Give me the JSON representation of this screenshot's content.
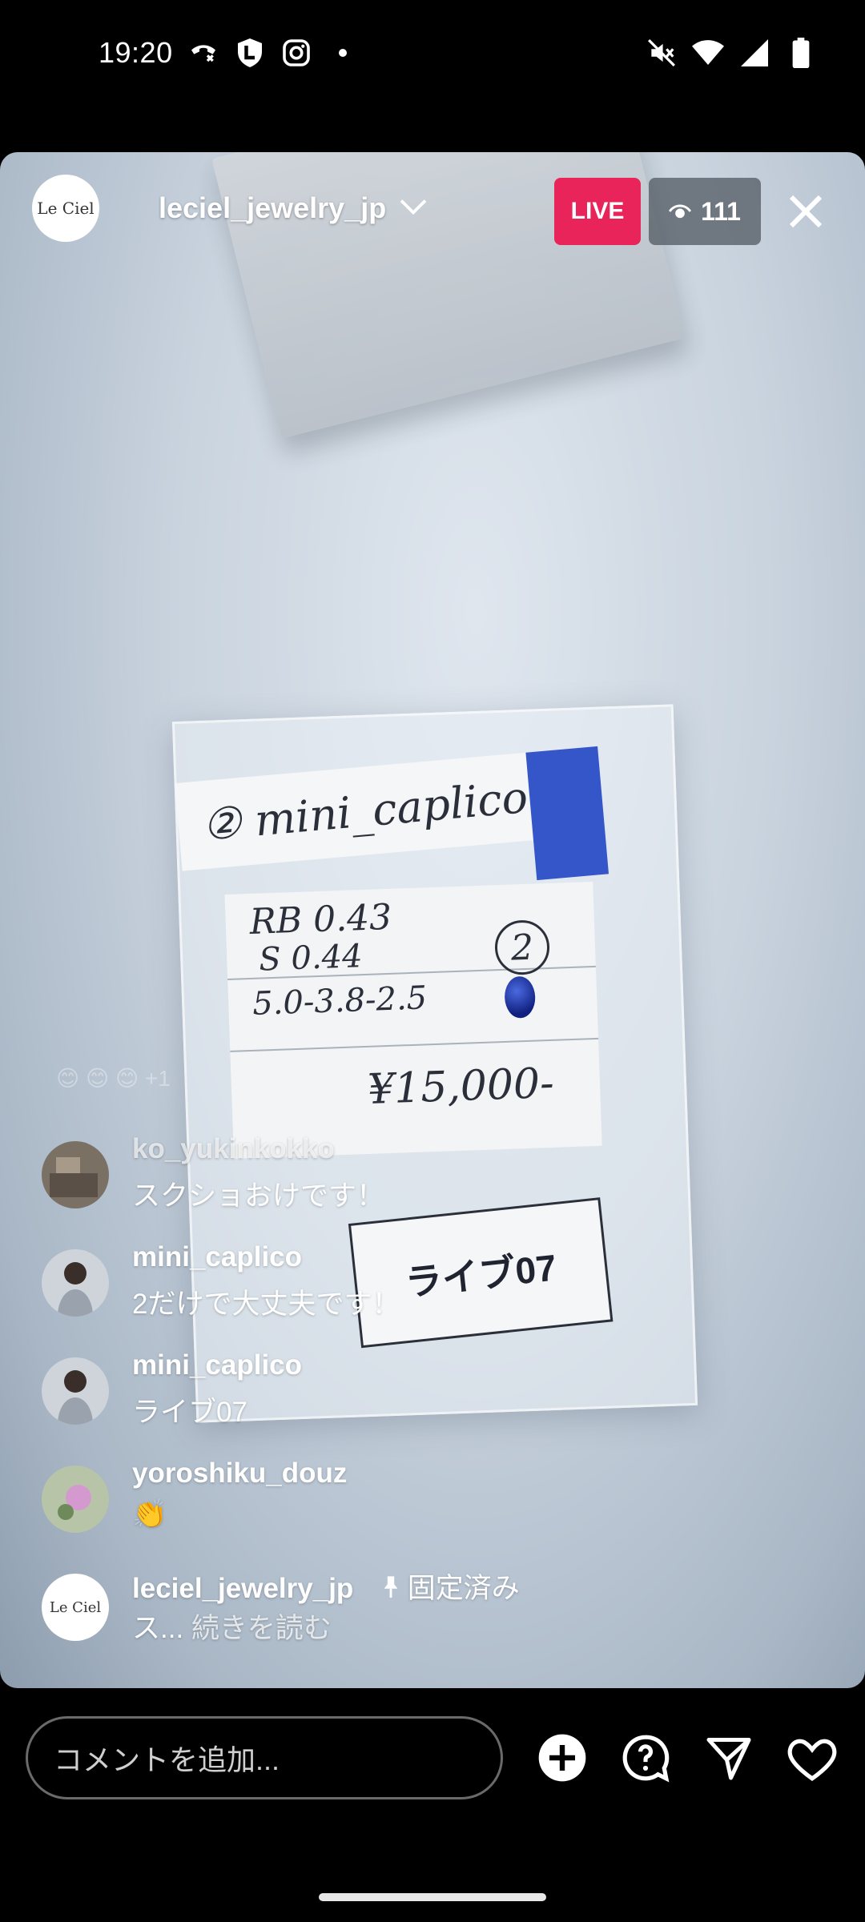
{
  "status_bar": {
    "time": "19:20",
    "icons_left": [
      "call-forward-icon",
      "shield-l-icon",
      "instagram-icon",
      "dot-icon"
    ],
    "icons_right": [
      "mute-icon",
      "wifi-icon",
      "signal-icon",
      "battery-icon"
    ]
  },
  "live": {
    "host_username": "leciel_jewelry_jp",
    "host_avatar_text": "Le Ciel",
    "live_label": "LIVE",
    "viewer_count": "111"
  },
  "video_content": {
    "label_top": "② mini_caplico",
    "card_line1": "RB 0.43",
    "card_line2": "S 0.44",
    "card_line3": "5.0-3.8-2.5",
    "card_price": "¥15,000-",
    "circle_number": "2",
    "live_tag": "ライブ07"
  },
  "comments": [
    {
      "username": "ko_yukinkokko",
      "text": "スクショおけです！"
    },
    {
      "username": "mini_caplico",
      "text": "2だけで大丈夫です！"
    },
    {
      "username": "mini_caplico",
      "text": "ライブ07"
    },
    {
      "username": "yoroshiku_douz",
      "text": "👏"
    },
    {
      "username": "leciel_jewelry_jp",
      "pinned_label": "固定済み",
      "text": "ス...",
      "more_label": "続きを読む",
      "avatar_text": "Le Ciel"
    }
  ],
  "faded_reactions": "😊 😊 😊 +1",
  "bottom": {
    "comment_placeholder": "コメントを追加..."
  },
  "colors": {
    "live_badge": "#e8245a",
    "viewer_badge": "#50585f"
  }
}
